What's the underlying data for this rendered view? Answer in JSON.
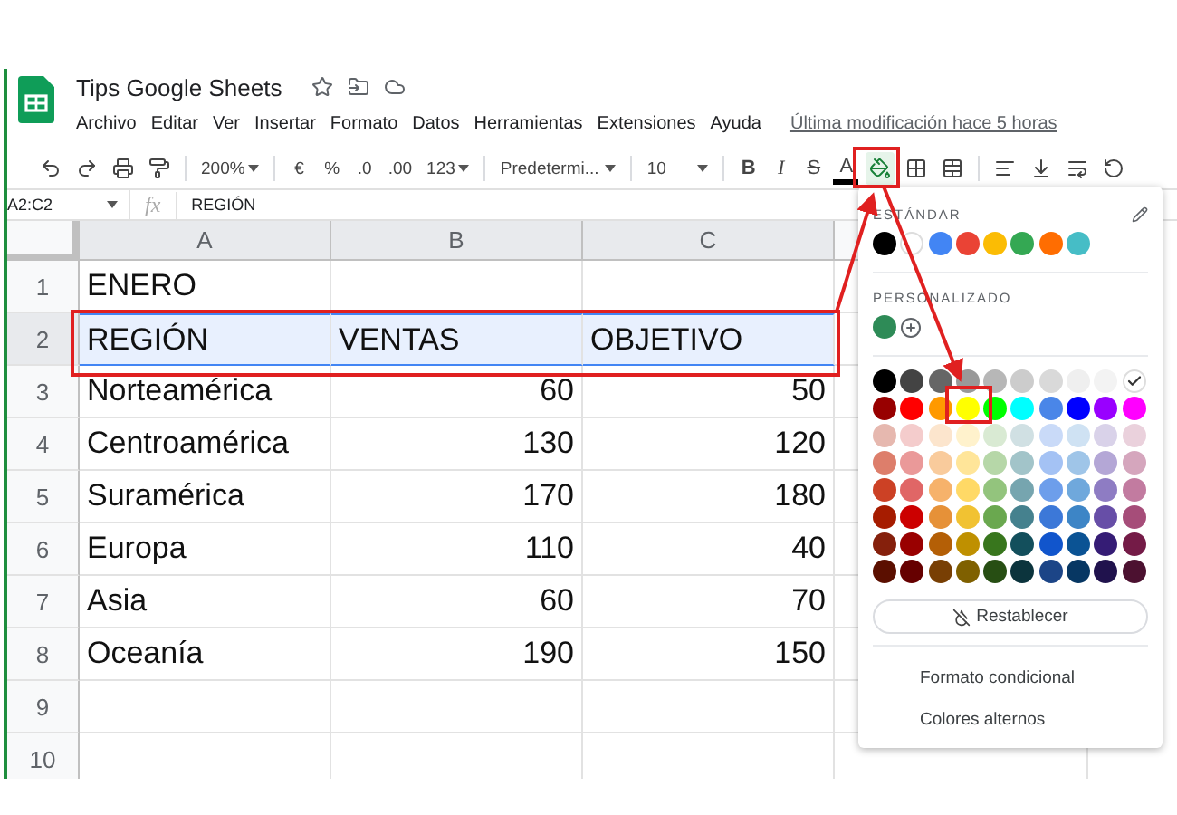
{
  "document": {
    "title": "Tips Google Sheets",
    "menu": [
      "Archivo",
      "Editar",
      "Ver",
      "Insertar",
      "Formato",
      "Datos",
      "Herramientas",
      "Extensiones",
      "Ayuda"
    ],
    "last_edit": "Última modificación hace 5 horas"
  },
  "toolbar": [
    {
      "kind": "undo"
    },
    {
      "kind": "redo"
    },
    {
      "kind": "print"
    },
    {
      "kind": "paint-format"
    },
    {
      "kind": "separator"
    },
    {
      "kind": "dropdown",
      "text": "200%"
    },
    {
      "kind": "separator"
    },
    {
      "kind": "text",
      "text": "€"
    },
    {
      "kind": "text",
      "text": "%"
    },
    {
      "kind": "text",
      "text": ".0"
    },
    {
      "kind": "text",
      "text": ".00"
    },
    {
      "kind": "dropdown",
      "text": "123"
    },
    {
      "kind": "separator"
    },
    {
      "kind": "wide-dropdown",
      "text": "Predetermi..."
    },
    {
      "kind": "separator"
    },
    {
      "kind": "wide-dropdown",
      "text": "10"
    },
    {
      "kind": "separator"
    },
    {
      "kind": "bold",
      "text": "B"
    },
    {
      "kind": "italic",
      "text": "I"
    },
    {
      "kind": "strike",
      "text": "S"
    },
    {
      "kind": "text-color",
      "text": "A"
    },
    {
      "kind": "fill",
      "selected": true
    },
    {
      "kind": "borders"
    },
    {
      "kind": "merge"
    },
    {
      "kind": "separator"
    },
    {
      "kind": "align"
    },
    {
      "kind": "valign"
    },
    {
      "kind": "wrap"
    },
    {
      "kind": "rotate"
    }
  ],
  "formula_bar": {
    "range": "A2:C2",
    "fx": "fx",
    "value": "REGIÓN"
  },
  "sheet": {
    "columns": [
      {
        "label": "A",
        "selected": true
      },
      {
        "label": "B",
        "selected": true
      },
      {
        "label": "C",
        "selected": true
      }
    ],
    "rows": [
      {
        "number": "1",
        "selected": false,
        "cells": [
          {
            "text": "ENERO",
            "kind": "text"
          }
        ]
      },
      {
        "number": "2",
        "selected": true,
        "cells": [
          {
            "text": "REGIÓN",
            "kind": "text"
          },
          {
            "text": "VENTAS",
            "kind": "text"
          },
          {
            "text": "OBJETIVO",
            "kind": "text"
          }
        ]
      },
      {
        "number": "3",
        "selected": false,
        "cells": [
          {
            "text": "Norteamérica",
            "kind": "text"
          },
          {
            "text": "60",
            "kind": "number"
          },
          {
            "text": "50",
            "kind": "number"
          }
        ]
      },
      {
        "number": "4",
        "selected": false,
        "cells": [
          {
            "text": "Centroamérica",
            "kind": "text"
          },
          {
            "text": "130",
            "kind": "number"
          },
          {
            "text": "120",
            "kind": "number"
          }
        ]
      },
      {
        "number": "5",
        "selected": false,
        "cells": [
          {
            "text": "Suramérica",
            "kind": "text"
          },
          {
            "text": "170",
            "kind": "number"
          },
          {
            "text": "180",
            "kind": "number"
          }
        ]
      },
      {
        "number": "6",
        "selected": false,
        "cells": [
          {
            "text": "Europa",
            "kind": "text"
          },
          {
            "text": "110",
            "kind": "number"
          },
          {
            "text": "40",
            "kind": "number"
          }
        ]
      },
      {
        "number": "7",
        "selected": false,
        "cells": [
          {
            "text": "Asia",
            "kind": "text"
          },
          {
            "text": "60",
            "kind": "number"
          },
          {
            "text": "70",
            "kind": "number"
          }
        ]
      },
      {
        "number": "8",
        "selected": false,
        "cells": [
          {
            "text": "Oceanía",
            "kind": "text"
          },
          {
            "text": "190",
            "kind": "number"
          },
          {
            "text": "150",
            "kind": "number"
          }
        ]
      },
      {
        "number": "9",
        "selected": false
      },
      {
        "number": "10",
        "selected": false
      }
    ]
  },
  "color_menu": {
    "standard_label": "ESTÁNDAR",
    "standard": [
      {
        "color": "#000000"
      },
      {
        "color": "#ffffff"
      },
      {
        "color": "#4285f4"
      },
      {
        "color": "#ea4335"
      },
      {
        "color": "#fbbc04"
      },
      {
        "color": "#34a853"
      },
      {
        "color": "#ff6d01"
      },
      {
        "color": "#46bdc6"
      }
    ],
    "custom_label": "PERSONALIZADO",
    "custom": [
      {
        "color": "#2e8b57"
      }
    ],
    "grid": [
      [
        {
          "color": "#000000",
          "selected": false
        },
        {
          "color": "#434343",
          "selected": false
        },
        {
          "color": "#666666",
          "selected": false
        },
        {
          "color": "#999999",
          "selected": false
        },
        {
          "color": "#b7b7b7",
          "selected": false
        },
        {
          "color": "#cccccc",
          "selected": false
        },
        {
          "color": "#d9d9d9",
          "selected": false
        },
        {
          "color": "#efefef",
          "selected": false
        },
        {
          "color": "#f3f3f3",
          "selected": false
        },
        {
          "color": "#ffffff",
          "selected": true
        }
      ],
      [
        {
          "color": "#980000",
          "selected": false
        },
        {
          "color": "#ff0000",
          "selected": false
        },
        {
          "color": "#ff9900",
          "selected": false
        },
        {
          "color": "#ffff00",
          "selected": false
        },
        {
          "color": "#00ff00",
          "selected": false
        },
        {
          "color": "#00ffff",
          "selected": false
        },
        {
          "color": "#4a86e8",
          "selected": false
        },
        {
          "color": "#0000ff",
          "selected": false
        },
        {
          "color": "#9900ff",
          "selected": false
        },
        {
          "color": "#ff00ff",
          "selected": false
        }
      ],
      [
        {
          "color": "#e6b8af",
          "selected": false
        },
        {
          "color": "#f4cccc",
          "selected": false
        },
        {
          "color": "#fce5cd",
          "selected": false
        },
        {
          "color": "#fff2cc",
          "selected": false
        },
        {
          "color": "#d9ead3",
          "selected": false
        },
        {
          "color": "#d0e0e3",
          "selected": false
        },
        {
          "color": "#c9daf8",
          "selected": false
        },
        {
          "color": "#cfe2f3",
          "selected": false
        },
        {
          "color": "#d9d2e9",
          "selected": false
        },
        {
          "color": "#ead1dc",
          "selected": false
        }
      ],
      [
        {
          "color": "#dd7e6b",
          "selected": false
        },
        {
          "color": "#ea9999",
          "selected": false
        },
        {
          "color": "#f9cb9c",
          "selected": false
        },
        {
          "color": "#ffe599",
          "selected": false
        },
        {
          "color": "#b6d7a8",
          "selected": false
        },
        {
          "color": "#a2c4c9",
          "selected": false
        },
        {
          "color": "#a4c2f4",
          "selected": false
        },
        {
          "color": "#9fc5e8",
          "selected": false
        },
        {
          "color": "#b4a7d6",
          "selected": false
        },
        {
          "color": "#d5a6bd",
          "selected": false
        }
      ],
      [
        {
          "color": "#cc4125",
          "selected": false
        },
        {
          "color": "#e06666",
          "selected": false
        },
        {
          "color": "#f6b26b",
          "selected": false
        },
        {
          "color": "#ffd966",
          "selected": false
        },
        {
          "color": "#93c47d",
          "selected": false
        },
        {
          "color": "#76a5af",
          "selected": false
        },
        {
          "color": "#6d9eeb",
          "selected": false
        },
        {
          "color": "#6fa8dc",
          "selected": false
        },
        {
          "color": "#8e7cc3",
          "selected": false
        },
        {
          "color": "#c27ba0",
          "selected": false
        }
      ],
      [
        {
          "color": "#a61c00",
          "selected": false
        },
        {
          "color": "#cc0000",
          "selected": false
        },
        {
          "color": "#e69138",
          "selected": false
        },
        {
          "color": "#f1c232",
          "selected": false
        },
        {
          "color": "#6aa84f",
          "selected": false
        },
        {
          "color": "#45818e",
          "selected": false
        },
        {
          "color": "#3c78d8",
          "selected": false
        },
        {
          "color": "#3d85c6",
          "selected": false
        },
        {
          "color": "#674ea7",
          "selected": false
        },
        {
          "color": "#a64d79",
          "selected": false
        }
      ],
      [
        {
          "color": "#85200c",
          "selected": false
        },
        {
          "color": "#990000",
          "selected": false
        },
        {
          "color": "#b45f06",
          "selected": false
        },
        {
          "color": "#bf9000",
          "selected": false
        },
        {
          "color": "#38761d",
          "selected": false
        },
        {
          "color": "#134f5c",
          "selected": false
        },
        {
          "color": "#1155cc",
          "selected": false
        },
        {
          "color": "#0b5394",
          "selected": false
        },
        {
          "color": "#351c75",
          "selected": false
        },
        {
          "color": "#741b47",
          "selected": false
        }
      ],
      [
        {
          "color": "#5b0f00",
          "selected": false
        },
        {
          "color": "#660000",
          "selected": false
        },
        {
          "color": "#783f04",
          "selected": false
        },
        {
          "color": "#7f6000",
          "selected": false
        },
        {
          "color": "#274e13",
          "selected": false
        },
        {
          "color": "#0c343d",
          "selected": false
        },
        {
          "color": "#1c4587",
          "selected": false
        },
        {
          "color": "#073763",
          "selected": false
        },
        {
          "color": "#20124d",
          "selected": false
        },
        {
          "color": "#4c1130",
          "selected": false
        }
      ]
    ],
    "reset": "Restablecer",
    "items": [
      "Formato condicional",
      "Colores alternos"
    ]
  }
}
